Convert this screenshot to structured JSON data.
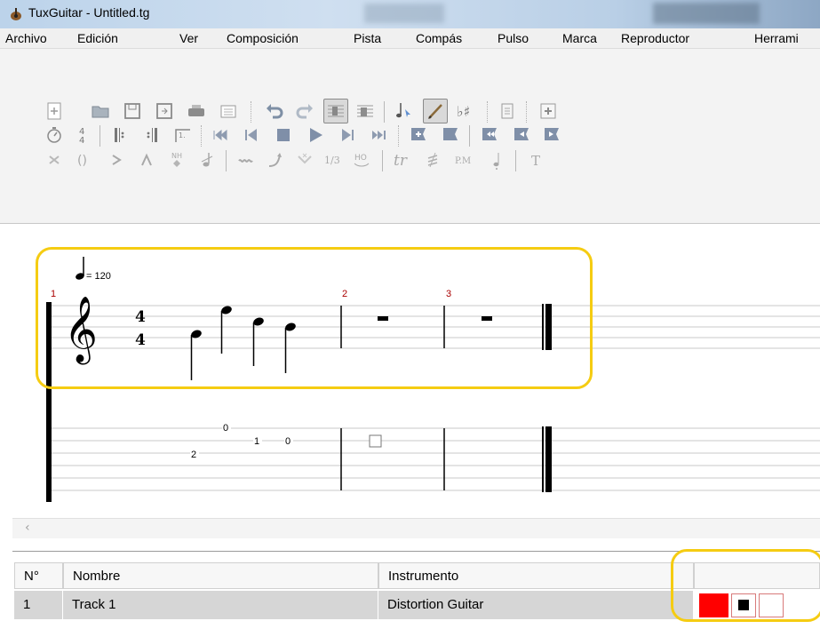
{
  "window": {
    "title": "TuxGuitar - Untitled.tg"
  },
  "menu": [
    "Archivo",
    "Edición",
    "Ver",
    "Composición",
    "Pista",
    "Compás",
    "Pulso",
    "Marca",
    "Reproductor",
    "Herrami"
  ],
  "score": {
    "tempo_label": "= 120",
    "time_signature": {
      "top": "4",
      "bottom": "4"
    },
    "measure_numbers": [
      "1",
      "2",
      "3"
    ],
    "tab_numbers": [
      "0",
      "1",
      "0",
      "2"
    ]
  },
  "tracks_table": {
    "headers": [
      "N°",
      "Nombre",
      "Instrumento"
    ],
    "rows": [
      {
        "number": "1",
        "name": "Track 1",
        "instrument": "Distortion Guitar"
      }
    ]
  },
  "toolbar_text": {
    "triplet": "1/3",
    "hammer_on": "HO",
    "trill": "tr",
    "palm_mute": "P.M",
    "text": "T",
    "harmonic": "NH"
  },
  "colors": {
    "track_color": "#ff0000",
    "highlight": "#f5cc12",
    "measure_number": "#aa0000"
  }
}
